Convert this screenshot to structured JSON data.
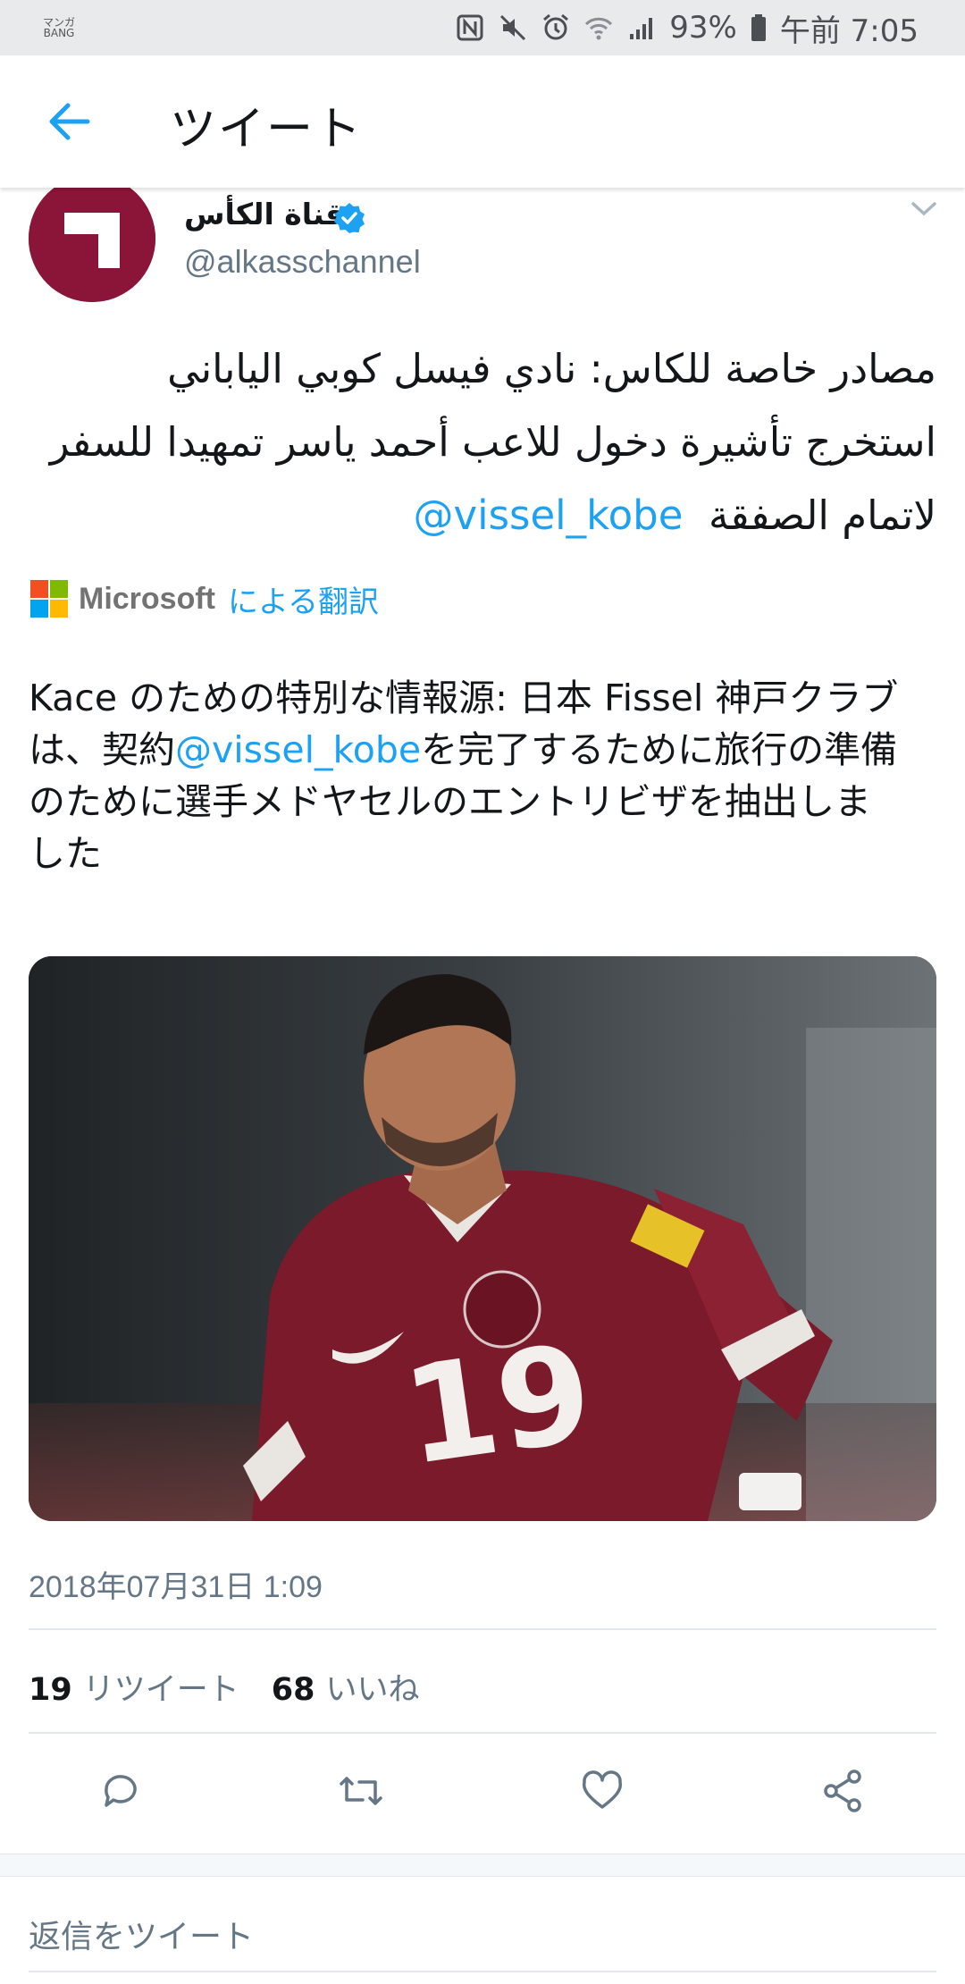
{
  "status_bar": {
    "app_badge": "マンガ BANG",
    "battery": "93%",
    "time": "午前 7:05",
    "icons": [
      "nfc-icon",
      "mute-icon",
      "alarm-icon",
      "wifi-icon",
      "signal-icon",
      "battery-icon"
    ]
  },
  "header": {
    "back_icon": "back-arrow-icon",
    "title": "ツイート"
  },
  "author": {
    "display_name": "قناة الكأس",
    "handle": "@alkasschannel",
    "verified": true
  },
  "tweet": {
    "arabic_lines": [
      "مصادر خاصة للكاس: نادي فيسل كوبي الياباني",
      "استخرج تأشيرة دخول للاعب أحمد ياسر تمهيدا للسفر",
      "لاتمام الصفقة"
    ],
    "arabic_mention": "@vissel_kobe",
    "translation_provider": "Microsoft",
    "translation_label": "による翻訳",
    "japanese_line1": "Kace のための特別な情報源: 日本 Fissel 神戸クラブ",
    "japanese_line2_pre": "は、契約",
    "japanese_mention": "@vissel_kobe",
    "japanese_line2_post": "を完了するために旅行の準備",
    "japanese_line3": "のために選手メドヤセルのエントリビザを抽出しま",
    "japanese_line4": "した",
    "photo_jersey_number": "19",
    "timestamp": "2018年07月31日 1:09"
  },
  "stats": {
    "retweets_count": "19",
    "retweets_label": "リツイート",
    "likes_count": "68",
    "likes_label": "いいね"
  },
  "actions": [
    "reply-icon",
    "retweet-icon",
    "like-icon",
    "share-icon"
  ],
  "reply": {
    "placeholder": "返信をツイート"
  },
  "colors": {
    "accent": "#1da1f2",
    "text": "#14171a",
    "muted": "#657786",
    "avatar_bg": "#8a1538"
  }
}
